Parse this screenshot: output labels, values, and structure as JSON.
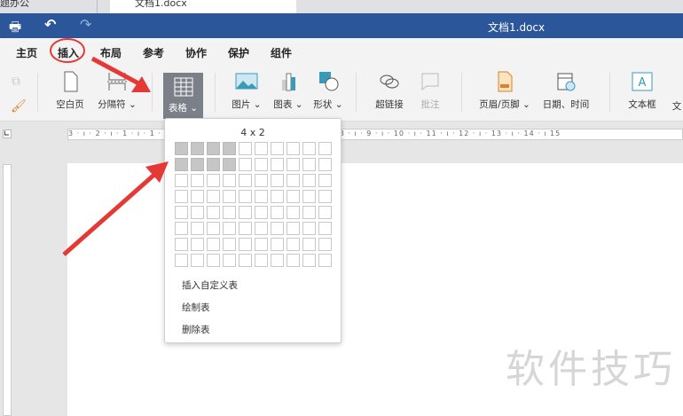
{
  "browser_tabs": [
    "题办公",
    "文档1.docx"
  ],
  "titlebar": {
    "title": "文档1.docx"
  },
  "menu_tabs": [
    "主页",
    "插入",
    "布局",
    "参考",
    "协作",
    "保护",
    "组件"
  ],
  "toolbar": {
    "blank_page": "空白页",
    "section_break": "分隔符",
    "table": "表格",
    "picture": "图片",
    "chart": "图表",
    "shape": "形状",
    "hyperlink": "超链接",
    "comment": "批注",
    "header_footer": "页眉/页脚",
    "date_time": "日期、时间",
    "textbox": "文本框",
    "wordart": "文"
  },
  "ruler": {
    "h_ticks": "3 · ı · 2 · ı · 1 · ı · 1 · ı · 2 · ı · 3 · ı · 4 · ı · 5 · ı · 6 · ı · 7 · ı · 8 · ı · 9 · ı · 10 · ı · 11 · ı · 12 · ı · 13 · ı · 14 · ı 15"
  },
  "table_popup": {
    "size_label": "4 x 2",
    "cols": 10,
    "rows": 8,
    "selected_cols": 4,
    "selected_rows": 2,
    "items": [
      "插入自定义表",
      "绘制表",
      "删除表"
    ]
  },
  "watermark": "软件技巧",
  "colors": {
    "titlebar": "#2b579a",
    "annotation": "#e53935"
  }
}
